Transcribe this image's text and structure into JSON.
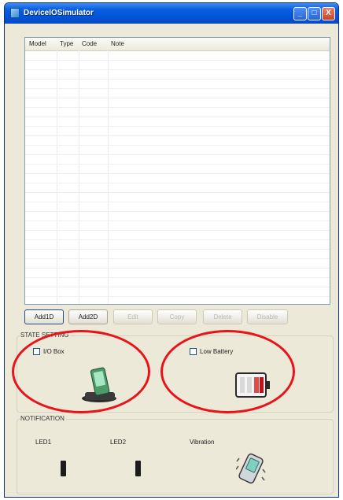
{
  "window": {
    "title": "DeviceIOSimulator",
    "controls": {
      "minimize": "_",
      "maximize": "□",
      "close": "X"
    }
  },
  "device_list": {
    "columns": [
      "Model",
      "Type",
      "Code",
      "Note"
    ],
    "rows": []
  },
  "toolbar": {
    "buttons": [
      {
        "label": "Add1D",
        "enabled": true
      },
      {
        "label": "Add2D",
        "enabled": true
      },
      {
        "label": "Edit",
        "enabled": false
      },
      {
        "label": "Copy",
        "enabled": false
      },
      {
        "label": "Delete",
        "enabled": false
      },
      {
        "label": "Disable",
        "enabled": false
      }
    ]
  },
  "state_setting": {
    "label": "STATE SETTING",
    "io_box": {
      "label": "I/O Box",
      "checked": false,
      "icon": "cradle-icon"
    },
    "low_battery": {
      "label": "Low Battery",
      "checked": false,
      "icon": "battery-icon"
    }
  },
  "notification": {
    "label": "NOTIFICATION",
    "led1": "LED1",
    "led2": "LED2",
    "vibration": {
      "label": "Vibration",
      "icon": "vibrating-device-icon"
    }
  },
  "colors": {
    "highlight_circle": "#e8141a",
    "titlebar": "#0052d6"
  }
}
